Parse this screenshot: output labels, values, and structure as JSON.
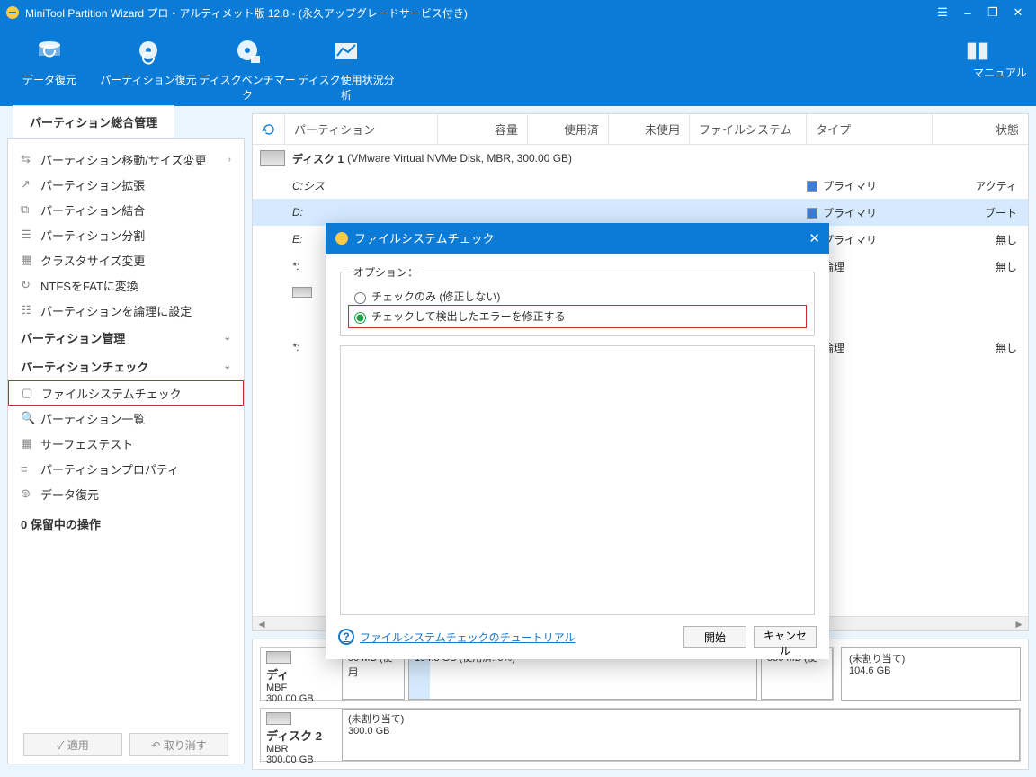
{
  "title_bar": {
    "caption": "MiniTool Partition Wizard プロ・アルティメット版 12.8 - (永久アップグレードサービス付き)"
  },
  "toolbar": {
    "data_recovery": "データ復元",
    "partition_recovery": "パーティション復元",
    "disk_benchmark": "ディスクベンチマーク",
    "space_analyzer": "ディスク使用状況分析",
    "manual": "マニュアル"
  },
  "sidebar": {
    "tab": "パーティション総合管理",
    "items_top": [
      "パーティション移動/サイズ変更",
      "パーティション拡張",
      "パーティション結合",
      "パーティション分割",
      "クラスタサイズ変更",
      "NTFSをFATに変換",
      "パーティションを論理に設定"
    ],
    "heading_manage": "パーティション管理",
    "heading_check": "パーティションチェック",
    "items_check": [
      "ファイルシステムチェック",
      "パーティション一覧",
      "サーフェステスト",
      "パーティションプロパティ",
      "データ復元"
    ],
    "pending": "0 保留中の操作",
    "apply": "適用",
    "undo": "取り消す"
  },
  "columns": {
    "partition": "パーティション",
    "capacity": "容量",
    "used": "使用済",
    "free": "未使用",
    "fs": "ファイルシステム",
    "type": "タイプ",
    "status": "状態"
  },
  "disk1": {
    "label": "ディスク 1",
    "detail": "(VMware Virtual NVMe Disk, MBR, 300.00 GB)"
  },
  "rows": [
    {
      "drive": "C:シス",
      "type_label": "プライマリ",
      "type_class": "primary",
      "status": "アクティ"
    },
    {
      "drive": "D:",
      "type_label": "プライマリ",
      "type_class": "primary",
      "status": "ブート",
      "selected": true
    },
    {
      "drive": "E:",
      "type_label": "プライマリ",
      "type_class": "primary",
      "status": "無し"
    },
    {
      "drive": "*:",
      "type_label": "論理",
      "type_class": "logical",
      "status": "無し"
    },
    {
      "drive": "",
      "type_label": "",
      "type_class": "",
      "status": ""
    },
    {
      "drive": "*:",
      "type_label": "論理",
      "type_class": "logical",
      "status": "無し"
    }
  ],
  "disk_map": {
    "d1": {
      "title": "ディ",
      "sub": "MBF",
      "size": "300.00 GB",
      "seg1": "50 MB (使用",
      "seg2": "194.8 GB (使用済: 6%)",
      "seg3": "556 MB (使"
    },
    "unalloc": {
      "title": "(未割り当て)",
      "size": "104.6 GB"
    },
    "d2": {
      "title": "ディスク 2",
      "sub": "MBR",
      "size": "300.00 GB",
      "seg": "(未割り当て)",
      "segsize": "300.0 GB"
    }
  },
  "dialog": {
    "title": "ファイルシステムチェック",
    "options_label": "オプション：",
    "opt1": "チェックのみ (修正しない)",
    "opt2": "チェックして検出したエラーを修正する",
    "tutorial": "ファイルシステムチェックのチュートリアル",
    "start": "開始",
    "cancel": "キャンセル"
  }
}
